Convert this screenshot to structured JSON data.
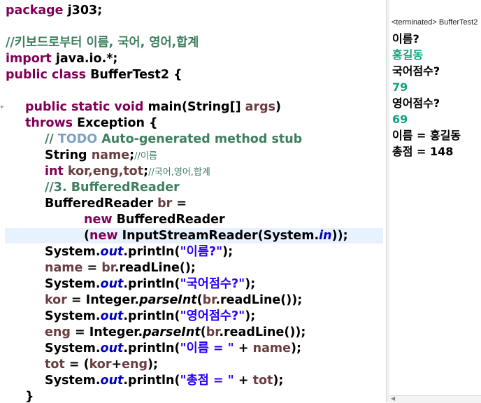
{
  "editor": {
    "package": {
      "kw": "package",
      "rest": " j303;"
    },
    "comment1": "//키보드로부터 이름, 국어, 영어,합계",
    "import": {
      "kw": "import",
      "rest": " java.io.*;"
    },
    "class_decl": {
      "kw1": "public",
      "kw2": "class",
      "rest": " BufferTest2 {"
    },
    "main_decl": {
      "kw1": "public",
      "kw2": "static",
      "kw3": "void",
      "rest": " main(String[] ",
      "arg": "args",
      "end": ")"
    },
    "throws": {
      "kw": "throws",
      "rest": " Exception {"
    },
    "todo_comment": {
      "prefix": "// ",
      "todo": "TODO",
      "rest": " Auto-generated method stub"
    },
    "decl_name": {
      "type": "String ",
      "var": "name",
      "semi": ";",
      "comment": "//이름"
    },
    "decl_int": {
      "kw": "int",
      "vars": " kor,eng,tot",
      "semi": ";",
      "comment": "//국어,영어,합계"
    },
    "comment3": "//3. BufferedReader",
    "br_decl": {
      "type": "BufferedReader ",
      "var": "br",
      "rest": " ="
    },
    "br_new": {
      "kw": "new",
      "rest": " BufferedReader"
    },
    "br_isr": {
      "open": "(",
      "kw": "new",
      "rest": " InputStreamReader(System.",
      "field": "in",
      "end": "));"
    },
    "statements": [
      {
        "a": "System.",
        "f": "out",
        "b": ".println(",
        "s": "\"이름?\"",
        "c": ");"
      },
      {
        "v": "name",
        "b": " = ",
        "v2": "br",
        "c": ".readLine();"
      },
      {
        "a": "System.",
        "f": "out",
        "b": ".println(",
        "s": "\"국어점수?\"",
        "c": ");"
      },
      {
        "v": "kor",
        "b": " = Integer.",
        "m": "parseInt",
        "b2": "(",
        "v2": "br",
        "c": ".readLine());"
      },
      {
        "a": "System.",
        "f": "out",
        "b": ".println(",
        "s": "\"영어점수?\"",
        "c": ");"
      },
      {
        "v": "eng",
        "b": " = Integer.",
        "m": "parseInt",
        "b2": "(",
        "v2": "br",
        "c": ".readLine());"
      },
      {
        "a": "System.",
        "f": "out",
        "b": ".println(",
        "s": "\"이름 = \"",
        "c": " + ",
        "v3": "name",
        "d": ");"
      },
      {
        "v": "tot",
        "b": " = (",
        "v2": "kor",
        "b3": "+",
        "v3": "eng",
        "c": ");"
      },
      {
        "a": "System.",
        "f": "out",
        "b": ".println(",
        "s": "\"총점 = \"",
        "c": " + ",
        "v3": "tot",
        "d": ");"
      }
    ],
    "closing_brace": "}"
  },
  "console": {
    "header": "<terminated> BufferTest2",
    "lines": [
      {
        "text": "이름?",
        "input": false
      },
      {
        "text": "홍길동",
        "input": true
      },
      {
        "text": "국어점수?",
        "input": false
      },
      {
        "text": "79",
        "input": true
      },
      {
        "text": "영어점수?",
        "input": false
      },
      {
        "text": "69",
        "input": true
      },
      {
        "text": "이름 = 홍길동",
        "input": false
      },
      {
        "text": "총점 = 148",
        "input": false
      }
    ]
  },
  "colors": {
    "keyword": "#7f0055",
    "comment": "#3f7f5f",
    "todo": "#7f9fbf",
    "string": "#2a00ff",
    "field": "#0000c0",
    "local_variable": "#6a3e3e",
    "console_input": "#11a37f",
    "current_line": "#e8f2fe"
  }
}
